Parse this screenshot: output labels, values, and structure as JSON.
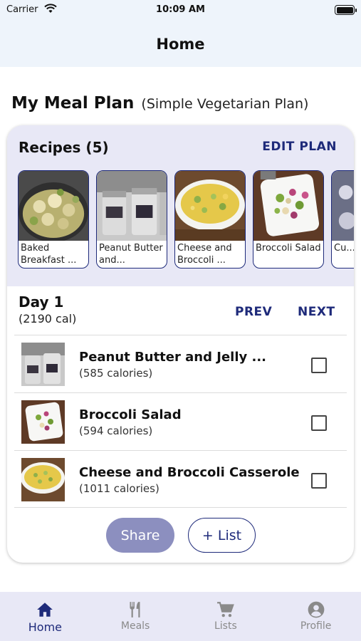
{
  "status": {
    "carrier": "Carrier",
    "time": "10:09 AM"
  },
  "nav": {
    "title": "Home"
  },
  "plan": {
    "heading": "My Meal Plan",
    "name": "(Simple Vegetarian Plan)"
  },
  "recipes": {
    "title": "Recipes (5)",
    "edit_label": "EDIT PLAN",
    "items": [
      {
        "name": "Baked Breakfast ..."
      },
      {
        "name": "Peanut Butter and..."
      },
      {
        "name": "Cheese and Broccoli ..."
      },
      {
        "name": "Broccoli Salad"
      },
      {
        "name": "Cu... an..."
      }
    ]
  },
  "day": {
    "label": "Day 1",
    "calories": "(2190 cal)",
    "prev_label": "PREV",
    "next_label": "NEXT",
    "meals": [
      {
        "name": "Peanut Butter and Jelly ...",
        "calories": "(585 calories)"
      },
      {
        "name": "Broccoli Salad",
        "calories": "(594 calories)"
      },
      {
        "name": "Cheese and Broccoli Casserole",
        "calories": "(1011 calories)"
      }
    ]
  },
  "actions": {
    "share_label": "Share",
    "list_label": "+ List"
  },
  "tabs": [
    {
      "label": "Home",
      "icon": "home-icon"
    },
    {
      "label": "Meals",
      "icon": "fork-knife-icon"
    },
    {
      "label": "Lists",
      "icon": "cart-icon"
    },
    {
      "label": "Profile",
      "icon": "person-circle-icon"
    }
  ],
  "colors": {
    "accent": "#1e2a7a",
    "band": "#e8e8f6",
    "header": "#eef4fb",
    "share": "#8c8fbf"
  }
}
